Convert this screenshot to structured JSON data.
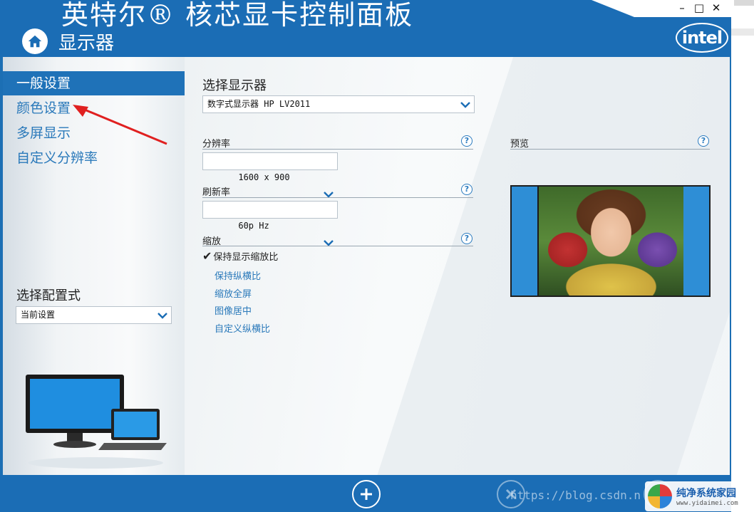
{
  "window": {
    "app_title": "英特尔® 核芯显卡控制面板",
    "page_title": "显示器",
    "controls": {
      "minimize": "–",
      "maximize": "□",
      "close": "✕"
    },
    "logo_text": "intel"
  },
  "sidebar": {
    "items": [
      {
        "label": "一般设置",
        "active": true
      },
      {
        "label": "颜色设置",
        "active": false
      },
      {
        "label": "多屏显示",
        "active": false
      },
      {
        "label": "自定义分辨率",
        "active": false
      }
    ],
    "profile_label": "选择配置式",
    "profile_value": "当前设置"
  },
  "main": {
    "select_display_label": "选择显示器",
    "display_value": "数字式显示器 HP LV2011",
    "resolution": {
      "label": "分辨率",
      "value": "1600 x 900"
    },
    "refresh": {
      "label": "刷新率",
      "value": "60p Hz"
    },
    "scaling": {
      "label": "缩放",
      "checked_option": "保持显示缩放比",
      "options": [
        "保持纵横比",
        "缩放全屏",
        "图像居中",
        "自定义纵横比"
      ]
    },
    "preview_label": "预览",
    "help_glyph": "?"
  },
  "footer": {
    "watermark_url": "https://blog.csdn.n",
    "brand_name": "纯净系统家园",
    "brand_site": "www.yidaimei.com"
  },
  "colors": {
    "header_blue": "#1b6db5",
    "link_blue": "#2a79ba",
    "annotation_red": "#e02020"
  }
}
